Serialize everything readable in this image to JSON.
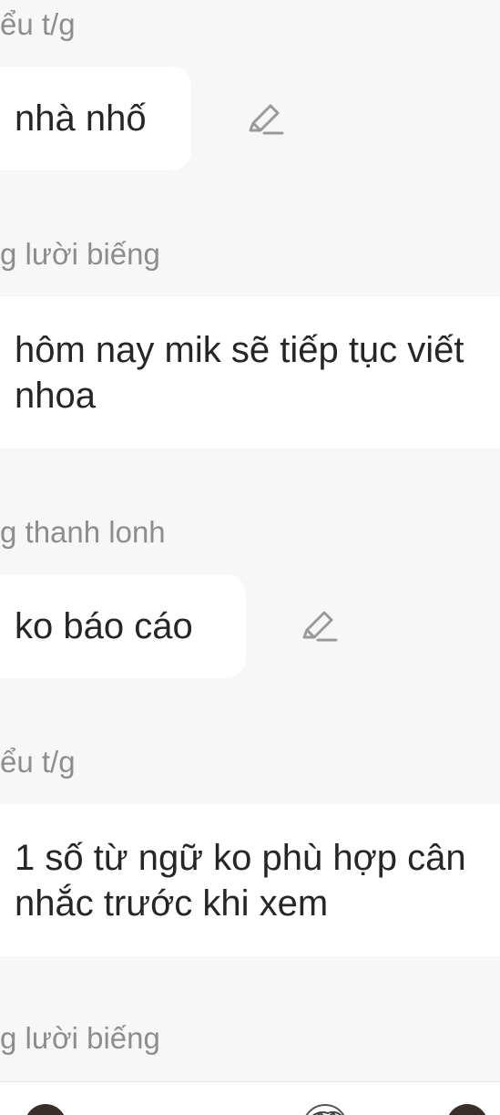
{
  "feed": {
    "items": [
      {
        "author": "ểu t/g",
        "message": "nhà nhố",
        "editable": true
      },
      {
        "author": "g lười biếng",
        "message_lines": [
          "hôm nay mik sẽ tiếp tục viết",
          "nhoa"
        ],
        "editable": false
      },
      {
        "author": "g thanh lonh",
        "message": "ko báo cáo",
        "editable": true
      },
      {
        "author": "ểu t/g",
        "message_lines": [
          "1 số từ ngữ ko phù hợp cân",
          "nhắc trước khi xem"
        ],
        "editable": false
      },
      {
        "author": "g lười biếng"
      }
    ]
  },
  "icons": {
    "edit": "pencil-icon"
  },
  "colors": {
    "background": "#f7f7f7",
    "bubble": "#ffffff",
    "label": "#8d8d8d",
    "text": "#262626",
    "icon": "#9a9a9a"
  }
}
